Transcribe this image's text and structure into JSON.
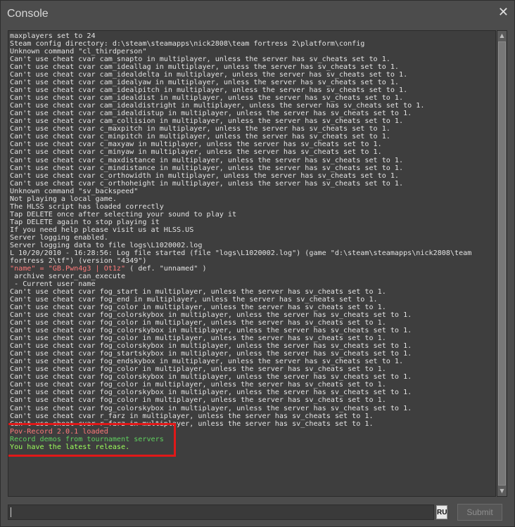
{
  "window": {
    "title": "Console",
    "close_icon": "✕"
  },
  "console_lines": [
    {
      "text": "maxplayers set to 24",
      "color": "default"
    },
    {
      "text": "Steam config directory: d:\\steam\\steamapps\\nick2808\\team fortress 2\\platform\\config",
      "color": "default"
    },
    {
      "text": "Unknown command \"cl_thirdperson\"",
      "color": "default"
    },
    {
      "text": "Can't use cheat cvar cam_snapto in multiplayer, unless the server has sv_cheats set to 1.",
      "color": "default"
    },
    {
      "text": "Can't use cheat cvar cam_ideallag in multiplayer, unless the server has sv_cheats set to 1.",
      "color": "default"
    },
    {
      "text": "Can't use cheat cvar cam_idealdelta in multiplayer, unless the server has sv_cheats set to 1.",
      "color": "default"
    },
    {
      "text": "Can't use cheat cvar cam_idealyaw in multiplayer, unless the server has sv_cheats set to 1.",
      "color": "default"
    },
    {
      "text": "Can't use cheat cvar cam_idealpitch in multiplayer, unless the server has sv_cheats set to 1.",
      "color": "default"
    },
    {
      "text": "Can't use cheat cvar cam_idealdist in multiplayer, unless the server has sv_cheats set to 1.",
      "color": "default"
    },
    {
      "text": "Can't use cheat cvar cam_idealdistright in multiplayer, unless the server has sv_cheats set to 1.",
      "color": "default"
    },
    {
      "text": "Can't use cheat cvar cam_idealdistup in multiplayer, unless the server has sv_cheats set to 1.",
      "color": "default"
    },
    {
      "text": "Can't use cheat cvar cam_collision in multiplayer, unless the server has sv_cheats set to 1.",
      "color": "default"
    },
    {
      "text": "Can't use cheat cvar c_maxpitch in multiplayer, unless the server has sv_cheats set to 1.",
      "color": "default"
    },
    {
      "text": "Can't use cheat cvar c_minpitch in multiplayer, unless the server has sv_cheats set to 1.",
      "color": "default"
    },
    {
      "text": "Can't use cheat cvar c_maxyaw in multiplayer, unless the server has sv_cheats set to 1.",
      "color": "default"
    },
    {
      "text": "Can't use cheat cvar c_minyaw in multiplayer, unless the server has sv_cheats set to 1.",
      "color": "default"
    },
    {
      "text": "Can't use cheat cvar c_maxdistance in multiplayer, unless the server has sv_cheats set to 1.",
      "color": "default"
    },
    {
      "text": "Can't use cheat cvar c_mindistance in multiplayer, unless the server has sv_cheats set to 1.",
      "color": "default"
    },
    {
      "text": "Can't use cheat cvar c_orthowidth in multiplayer, unless the server has sv_cheats set to 1.",
      "color": "default"
    },
    {
      "text": "Can't use cheat cvar c_orthoheight in multiplayer, unless the server has sv_cheats set to 1.",
      "color": "default"
    },
    {
      "text": "Unknown command \"sv_backspeed\"",
      "color": "default"
    },
    {
      "text": "Not playing a local game.",
      "color": "default"
    },
    {
      "text": "The HLSS script has loaded correctly",
      "color": "default"
    },
    {
      "text": "Tap DELETE once after selecting your sound to play it",
      "color": "default"
    },
    {
      "text": "Tap DELETE again to stop playing it",
      "color": "default"
    },
    {
      "text": "If you need help please visit us at HLSS.US",
      "color": "default"
    },
    {
      "text": "Server logging enabled.",
      "color": "default"
    },
    {
      "text": "Server logging data to file logs\\L1020002.log",
      "color": "default"
    },
    {
      "text": "L 10/20/2010 - 16:28:56: Log file started (file \"logs\\L1020002.log\") (game \"d:\\steam\\steamapps\\nick2808\\team",
      "color": "default"
    },
    {
      "text": "fortress 2\\tf\") (version \"4349\")",
      "color": "default"
    },
    {
      "text": "\"name\" = \"GB.Pwn4g3 | Ot1z\"",
      "suffix": " ( def. \"unnamed\" )",
      "color": "mixed"
    },
    {
      "text": " archive server_can_execute",
      "color": "default"
    },
    {
      "text": " - Current user name",
      "color": "default"
    },
    {
      "text": "Can't use cheat cvar fog_start in multiplayer, unless the server has sv_cheats set to 1.",
      "color": "default"
    },
    {
      "text": "Can't use cheat cvar fog_end in multiplayer, unless the server has sv_cheats set to 1.",
      "color": "default"
    },
    {
      "text": "Can't use cheat cvar fog_color in multiplayer, unless the server has sv_cheats set to 1.",
      "color": "default"
    },
    {
      "text": "Can't use cheat cvar fog_colorskybox in multiplayer, unless the server has sv_cheats set to 1.",
      "color": "default"
    },
    {
      "text": "Can't use cheat cvar fog_color in multiplayer, unless the server has sv_cheats set to 1.",
      "color": "default"
    },
    {
      "text": "Can't use cheat cvar fog_colorskybox in multiplayer, unless the server has sv_cheats set to 1.",
      "color": "default"
    },
    {
      "text": "Can't use cheat cvar fog_color in multiplayer, unless the server has sv_cheats set to 1.",
      "color": "default"
    },
    {
      "text": "Can't use cheat cvar fog_colorskybox in multiplayer, unless the server has sv_cheats set to 1.",
      "color": "default"
    },
    {
      "text": "Can't use cheat cvar fog_startskybox in multiplayer, unless the server has sv_cheats set to 1.",
      "color": "default"
    },
    {
      "text": "Can't use cheat cvar fog_endskybox in multiplayer, unless the server has sv_cheats set to 1.",
      "color": "default"
    },
    {
      "text": "Can't use cheat cvar fog_color in multiplayer, unless the server has sv_cheats set to 1.",
      "color": "default"
    },
    {
      "text": "Can't use cheat cvar fog_colorskybox in multiplayer, unless the server has sv_cheats set to 1.",
      "color": "default"
    },
    {
      "text": "Can't use cheat cvar fog_color in multiplayer, unless the server has sv_cheats set to 1.",
      "color": "default"
    },
    {
      "text": "Can't use cheat cvar fog_colorskybox in multiplayer, unless the server has sv_cheats set to 1.",
      "color": "default"
    },
    {
      "text": "Can't use cheat cvar fog_color in multiplayer, unless the server has sv_cheats set to 1.",
      "color": "default"
    },
    {
      "text": "Can't use cheat cvar fog_colorskybox in multiplayer, unless the server has sv_cheats set to 1.",
      "color": "default"
    },
    {
      "text": "Can't use cheat cvar r_farz in multiplayer, unless the server has sv_cheats set to 1.",
      "color": "default"
    },
    {
      "text": "Can't use cheat cvar r_farz in multiplayer, unless the server has sv_cheats set to 1.",
      "color": "default"
    },
    {
      "text": "Pov-Record 2.0.1 loaded",
      "color": "red"
    },
    {
      "text": "Record demos from tournament servers",
      "color": "green"
    },
    {
      "text": "You have the latest release.",
      "color": "lime"
    }
  ],
  "colors": {
    "default": "#e3e3e3",
    "red": "#ff7a7a",
    "green": "#5fd05f",
    "lime": "#9cff5c",
    "highlight_box": "#e01818"
  },
  "scrollbar": {
    "up_icon": "▲",
    "down_icon": "▼"
  },
  "command_input": {
    "value": "",
    "placeholder": ""
  },
  "language_badge": "RU",
  "submit_label": "Submit"
}
